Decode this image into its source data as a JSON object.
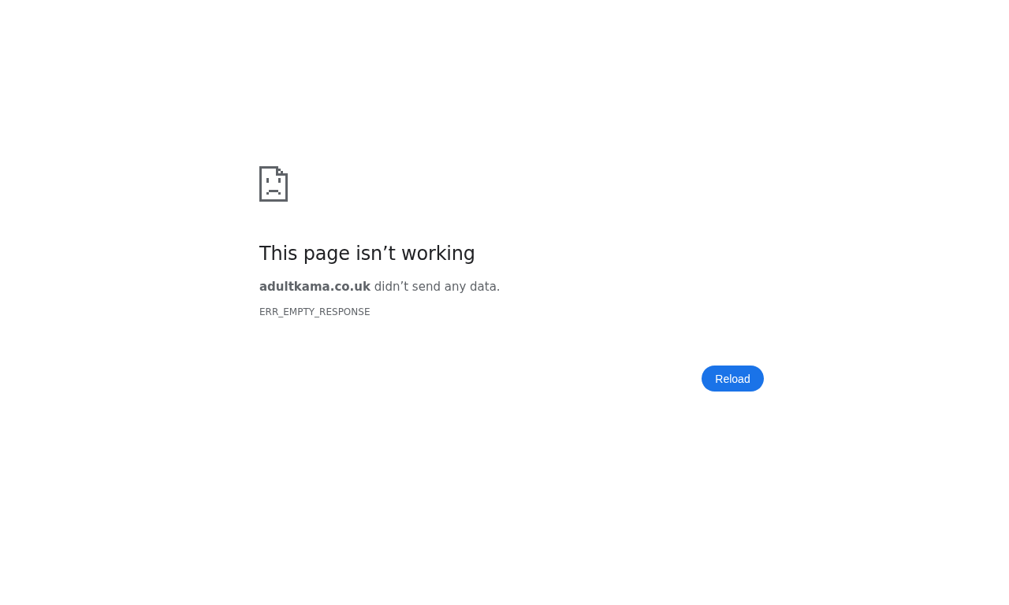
{
  "error": {
    "heading": "This page isn’t working",
    "message": "**adultkama.co.uk** didn’t send any data.",
    "code": "ERR_EMPTY_RESPONSE"
  },
  "buttons": [
    {
      "label": "Reload"
    }
  ]
}
